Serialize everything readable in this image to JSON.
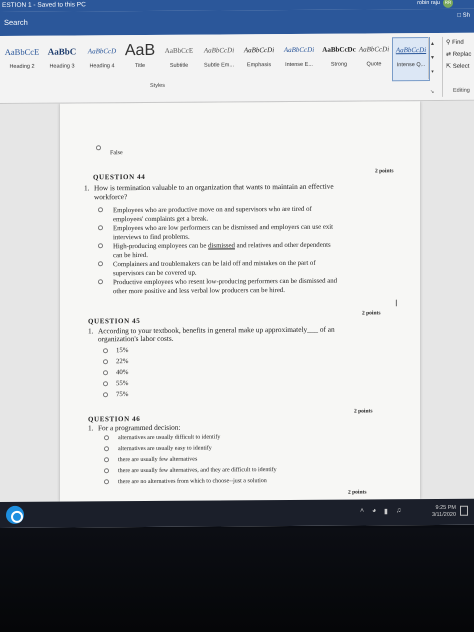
{
  "window": {
    "title": "ESTION 1 - Saved to this PC",
    "user_name": "robin raju",
    "user_initials": "RR"
  },
  "searchbar": {
    "label": "Search",
    "share_label": "Sh"
  },
  "ribbon": {
    "styles": [
      {
        "sample": "AaBbCcE",
        "name": "Heading 2"
      },
      {
        "sample": "AaBbC",
        "name": "Heading 3"
      },
      {
        "sample": "AaBbCcD",
        "name": "Heading 4"
      },
      {
        "sample": "AaB",
        "name": "Title"
      },
      {
        "sample": "AaBbCcE",
        "name": "Subtitle"
      },
      {
        "sample": "AaBbCcDi",
        "name": "Subtle Em..."
      },
      {
        "sample": "AaBbCcDi",
        "name": "Emphasis"
      },
      {
        "sample": "AaBbCcDi",
        "name": "Intense E..."
      },
      {
        "sample": "AaBbCcDc",
        "name": "Strong"
      },
      {
        "sample": "AaBbCcDi",
        "name": "Quote"
      },
      {
        "sample": "AaBbCcDi",
        "name": "Intense Q..."
      }
    ],
    "styles_group_label": "Styles",
    "editing": {
      "find": "Find",
      "replace": "Replac",
      "select": "Select",
      "group_label": "Editing"
    }
  },
  "document": {
    "prev_answer": "False",
    "q44": {
      "title": "QUESTION 44",
      "points": "2 points",
      "number": "1.",
      "text_line1": "How is termination valuable to an organization that wants to maintain an effective",
      "text_line2": "workforce?",
      "options": [
        {
          "line1": "Employees who are productive move on and supervisors who are tired of",
          "line2": "employees' complaints get a break."
        },
        {
          "line1": "Employees who are low performers can be dismissed and employers can use exit",
          "line2": "interviews to find problems."
        },
        {
          "line1_a": "High-producing employees can be ",
          "line1_u": "dismissed",
          "line1_b": " and relatives and other dependents",
          "line2": "can be hired."
        },
        {
          "line1": "Complainers and troublemakers can be laid off and mistakes on the part of",
          "line2": "supervisors can be covered up."
        },
        {
          "line1": "Productive employees who resent low-producing performers can be dismissed and",
          "line2": "other more positive and less verbal low producers can be hired."
        }
      ]
    },
    "q45": {
      "title": "QUESTION 45",
      "points": "2 points",
      "number": "1.",
      "text_line1": "According to your textbook, benefits in general make up approximately___ of an",
      "text_line2": "organization's labor costs.",
      "options": [
        "15%",
        "22%",
        "40%",
        "55%",
        "75%"
      ]
    },
    "q46": {
      "title": "QUESTION 46",
      "points": "2 points",
      "number": "1.",
      "text": "For a programmed decision:",
      "options": [
        "alternatives are usually difficult to identify",
        "alternatives are usually easy to identify",
        "there are usually few alternatives",
        "there are usually few alternatives, and they are difficult to identify",
        "there are no alternatives from which to choose--just a solution"
      ],
      "next_points": "2 points"
    }
  },
  "taskbar": {
    "time": "9:25 PM",
    "date": "3/11/2020"
  }
}
